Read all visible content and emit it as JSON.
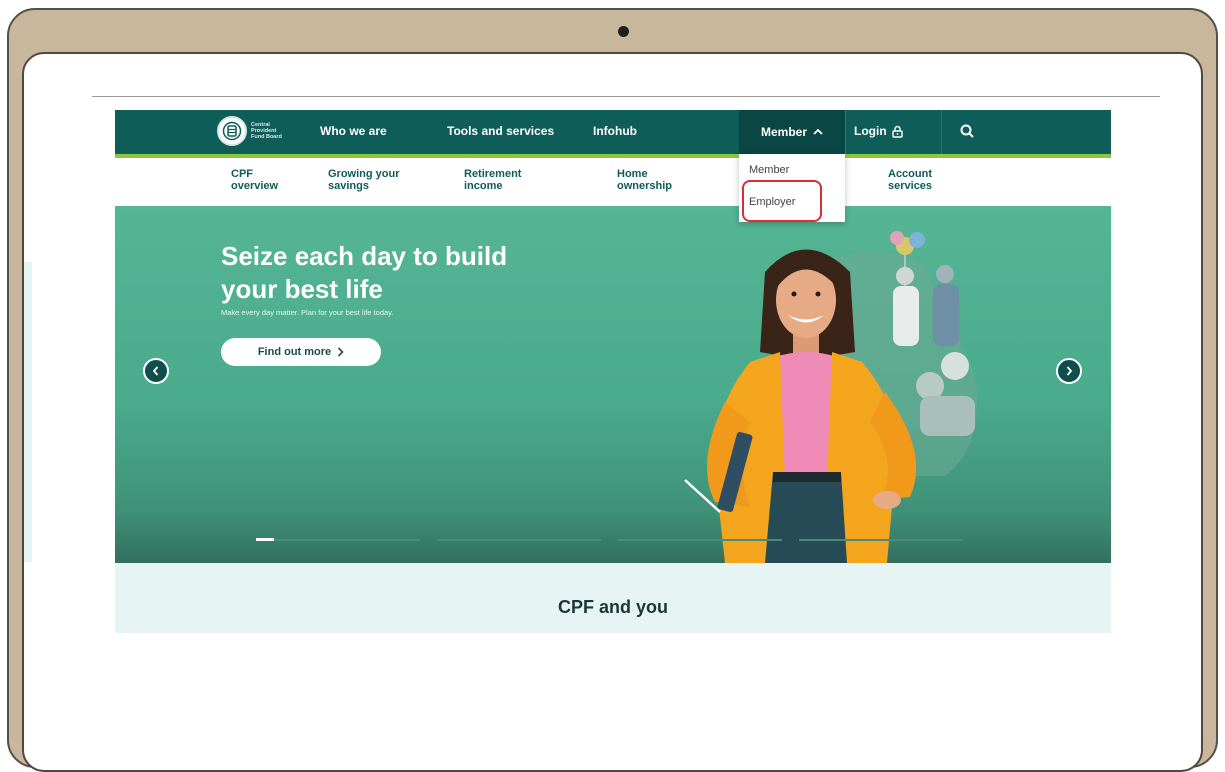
{
  "colors": {
    "bezel": "#c8b79d",
    "brand_dark_green": "#0f5d59",
    "accent_lime": "#8cc63f",
    "hero_green": "#4aab8c",
    "highlight_red": "#d62f3a"
  },
  "logo": {
    "line1": "Central",
    "line2": "Provident",
    "line3": "Fund Board"
  },
  "nav": {
    "who_we_are": "Who we are",
    "tools_and_services": "Tools and services",
    "infohub": "Infohub",
    "member": "Member",
    "login": "Login",
    "search_icon": "search-icon",
    "lock_icon": "lock-icon",
    "chevron_up_icon": "chevron-up-icon"
  },
  "subnav": {
    "items": [
      {
        "line1": "CPF",
        "line2": "overview"
      },
      {
        "line1": "Growing your",
        "line2": "savings"
      },
      {
        "line1": "Retirement",
        "line2": "income"
      },
      {
        "line1": "Home",
        "line2": "ownership"
      },
      {
        "line1": "Account",
        "line2": "services"
      }
    ]
  },
  "dropdown": {
    "items": [
      "Member",
      "Employer"
    ],
    "highlighted": "Employer"
  },
  "hero": {
    "title_line1": "Seize each day to build",
    "title_line2": "your best life",
    "subtitle": "Make every day matter. Plan for your best life today.",
    "cta_label": "Find out more",
    "cta_icon": "chevron-right-icon",
    "prev_icon": "chevron-left-icon",
    "next_icon": "chevron-right-icon",
    "carousel_slides": 4,
    "active_slide": 1
  },
  "section": {
    "title": "CPF and you"
  }
}
